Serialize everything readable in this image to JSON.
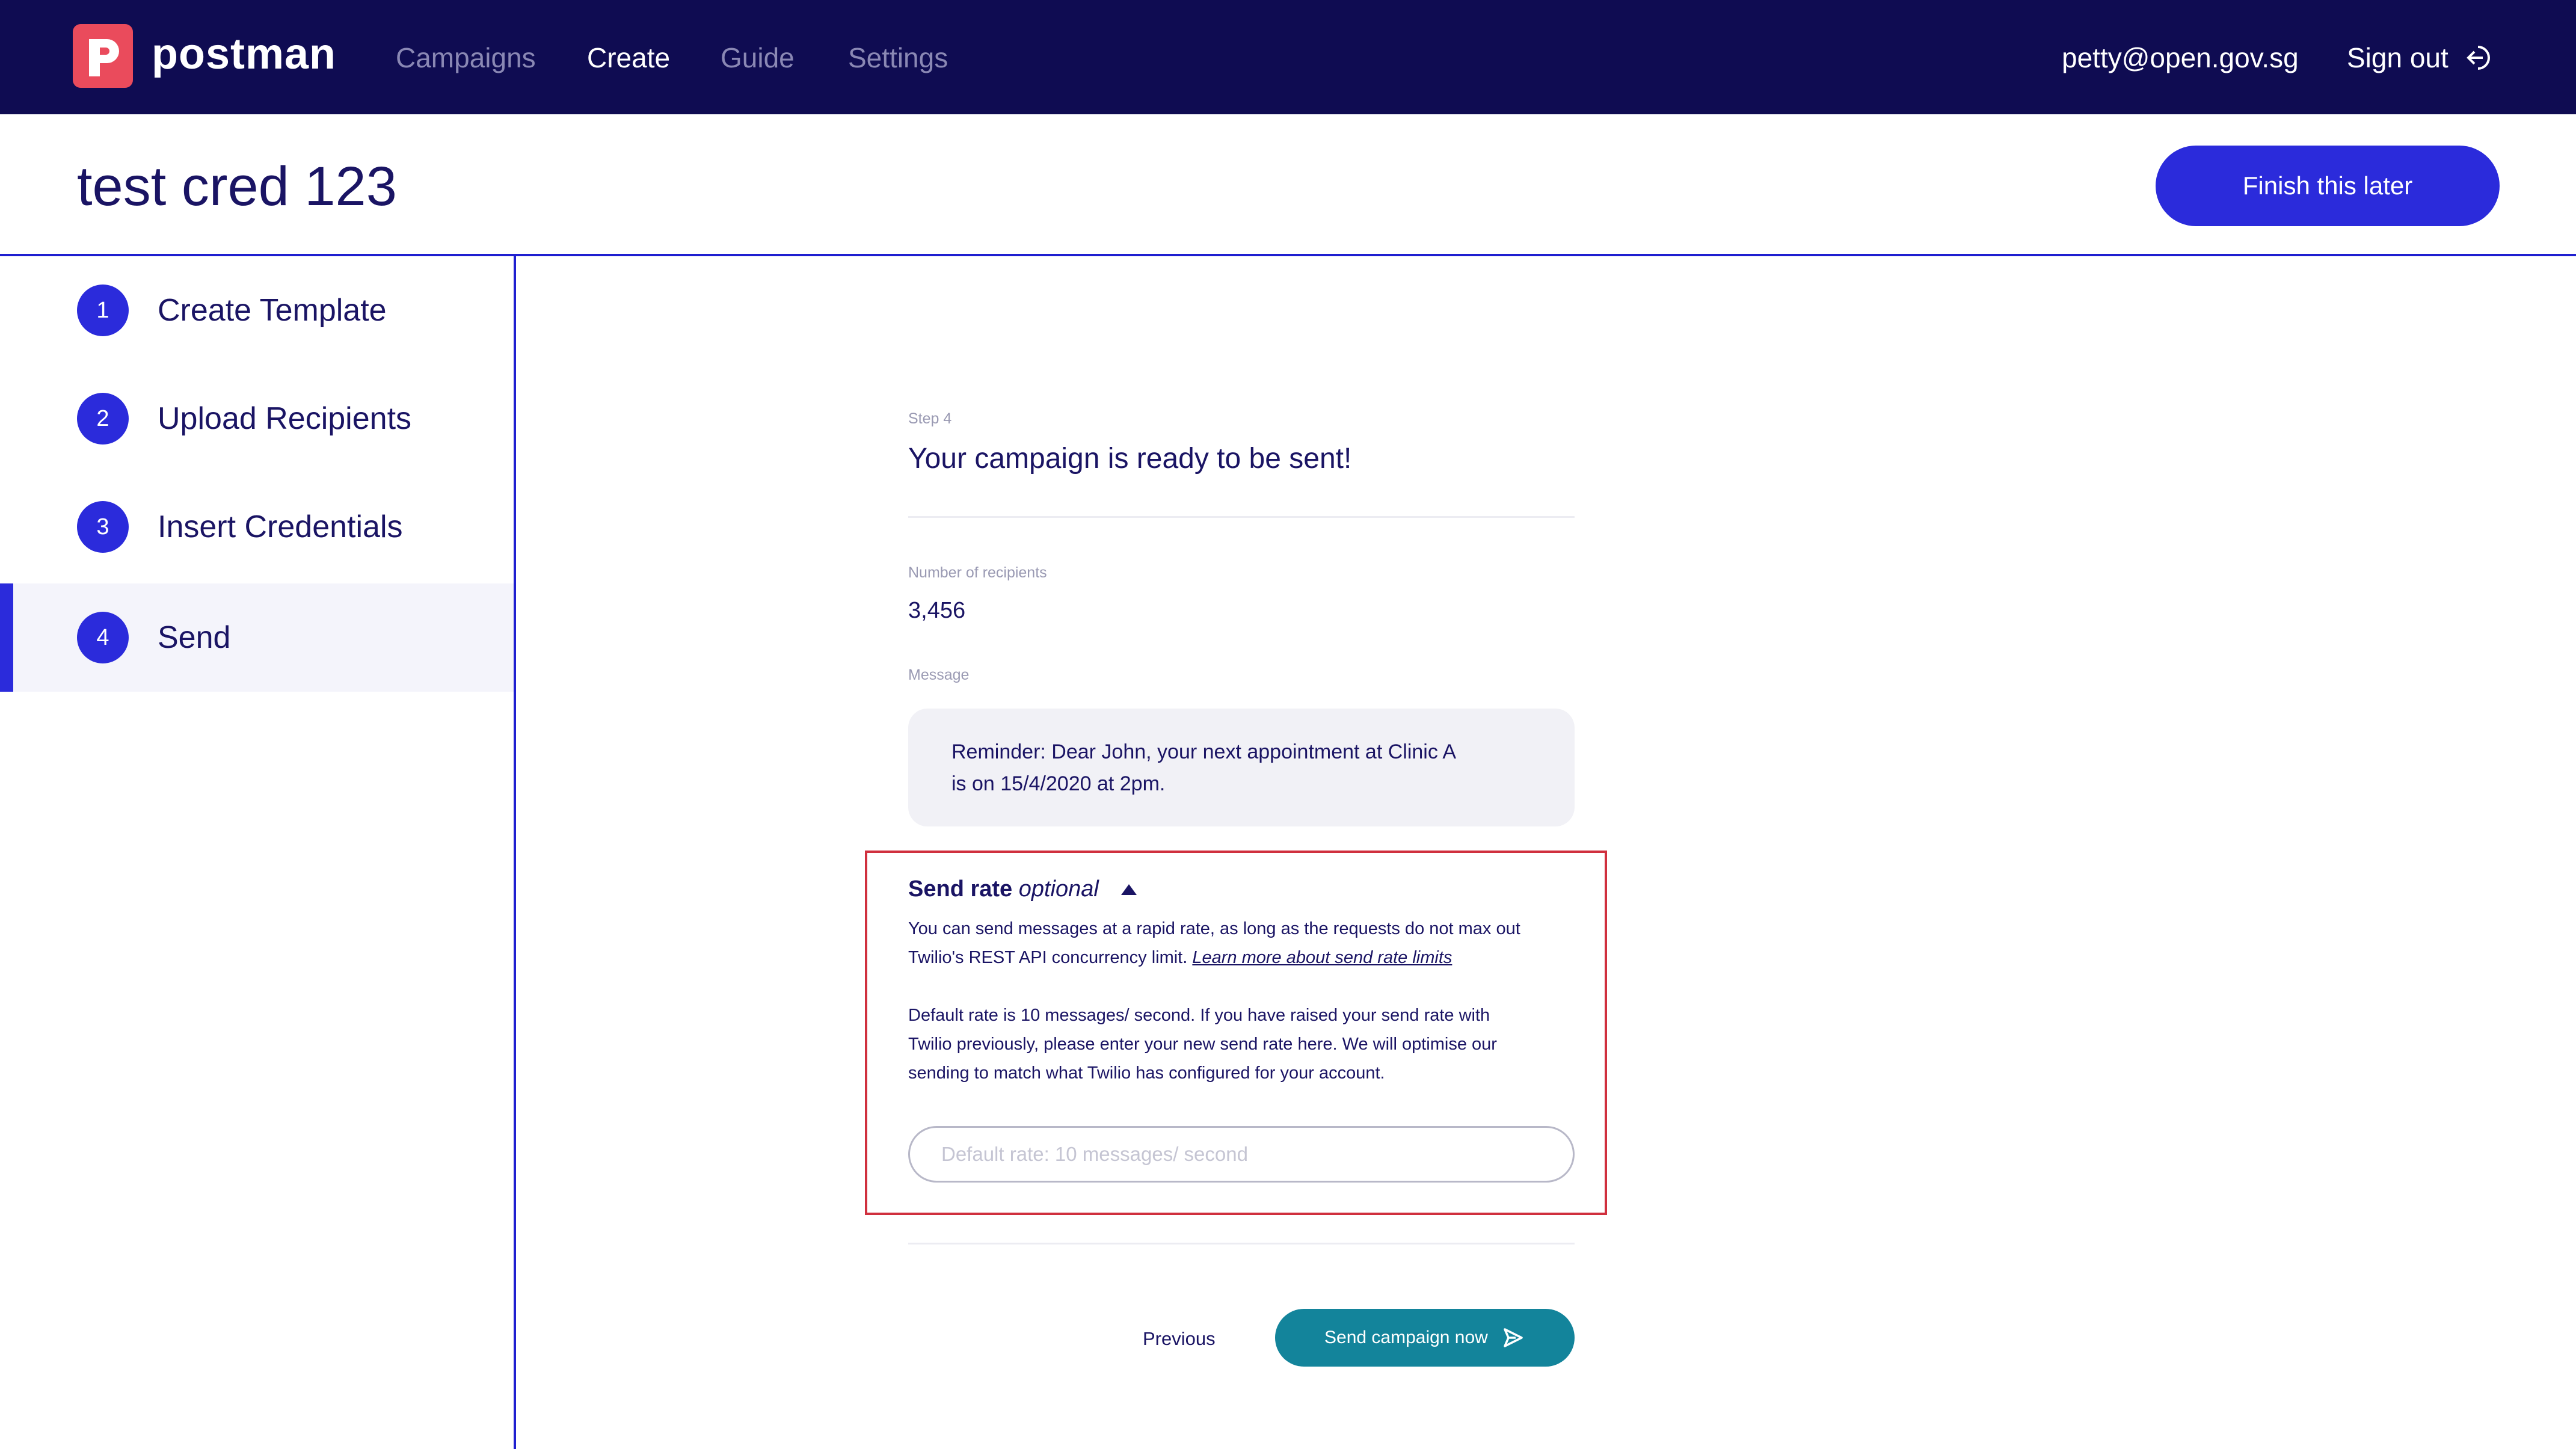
{
  "navbar": {
    "brand": "postman",
    "links": [
      "Campaigns",
      "Create",
      "Guide",
      "Settings"
    ],
    "active_link": "Create",
    "user_email": "petty@open.gov.sg",
    "signout_label": "Sign out"
  },
  "header": {
    "title": "test cred 123",
    "finish_label": "Finish this later"
  },
  "sidebar": {
    "steps": [
      {
        "num": "1",
        "label": "Create Template"
      },
      {
        "num": "2",
        "label": "Upload Recipients"
      },
      {
        "num": "3",
        "label": "Insert Credentials"
      },
      {
        "num": "4",
        "label": "Send"
      }
    ],
    "active_step": "4"
  },
  "main": {
    "step_caption": "Step 4",
    "heading": "Your campaign is ready to be sent!",
    "recipients_label": "Number of recipients",
    "recipients_value": "3,456",
    "message_label": "Message",
    "message_line1": "Reminder: Dear John, your next appointment at Clinic A",
    "message_line2": "is on 15/4/2020 at 2pm.",
    "send_rate": {
      "title": "Send rate",
      "optional": "optional",
      "para1_line1": "You can send messages at a rapid rate, as long as the requests do not max out",
      "para1_line2": "Twilio's REST API concurrency limit.",
      "learn_more": "Learn more about send rate limits",
      "para2_line1": "Default rate is 10 messages/ second. If you have raised your send rate with",
      "para2_line2": "Twilio previously, please enter your new send rate here. We will optimise our",
      "para2_line3": "sending to match what Twilio has configured for your account.",
      "input_placeholder": "Default rate: 10 messages/ second",
      "input_value": ""
    },
    "previous_label": "Previous",
    "send_label": "Send campaign now"
  },
  "colors": {
    "navbar_bg": "#0f0c52",
    "accent": "#2b2bdb",
    "send_button": "#13849b",
    "highlight_border": "#d0303e",
    "logo": "#ea4b5c"
  },
  "icons": [
    "postman-logo-icon",
    "sign-out-icon",
    "caret-up-icon",
    "send-icon"
  ]
}
